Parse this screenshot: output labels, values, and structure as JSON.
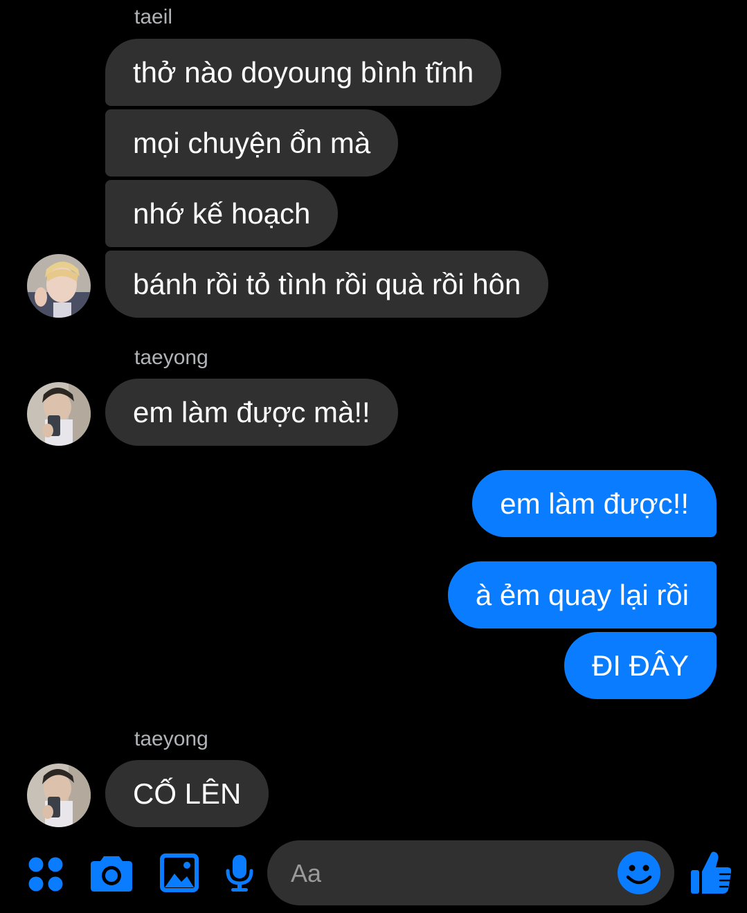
{
  "theme": {
    "background": "#000000",
    "incoming_bubble": "#303030",
    "outgoing_bubble": "#0a7cff",
    "accent": "#0a7cff",
    "sender_name_color": "#b0b3b8"
  },
  "conversation": {
    "groups": [
      {
        "sender": "taeil",
        "direction": "incoming",
        "messages": [
          "thở nào doyoung bình tĩnh",
          "mọi chuyện ổn mà",
          "nhớ kế hoạch",
          "bánh rồi tỏ tình rồi quà rồi hôn"
        ]
      },
      {
        "sender": "taeyong",
        "direction": "incoming",
        "messages": [
          "em làm được mà!!"
        ]
      },
      {
        "sender": "",
        "direction": "outgoing",
        "messages": [
          "em làm được!!",
          "à ẻm quay lại rồi",
          "ĐI ĐÂY"
        ]
      },
      {
        "sender": "taeyong",
        "direction": "incoming",
        "messages": [
          "CỐ LÊN"
        ]
      }
    ]
  },
  "composer": {
    "icons": [
      "apps-grid-icon",
      "camera-icon",
      "gallery-icon",
      "microphone-icon",
      "emoji-icon",
      "thumbs-up-icon"
    ],
    "input_placeholder": "Aa",
    "input_value": ""
  }
}
